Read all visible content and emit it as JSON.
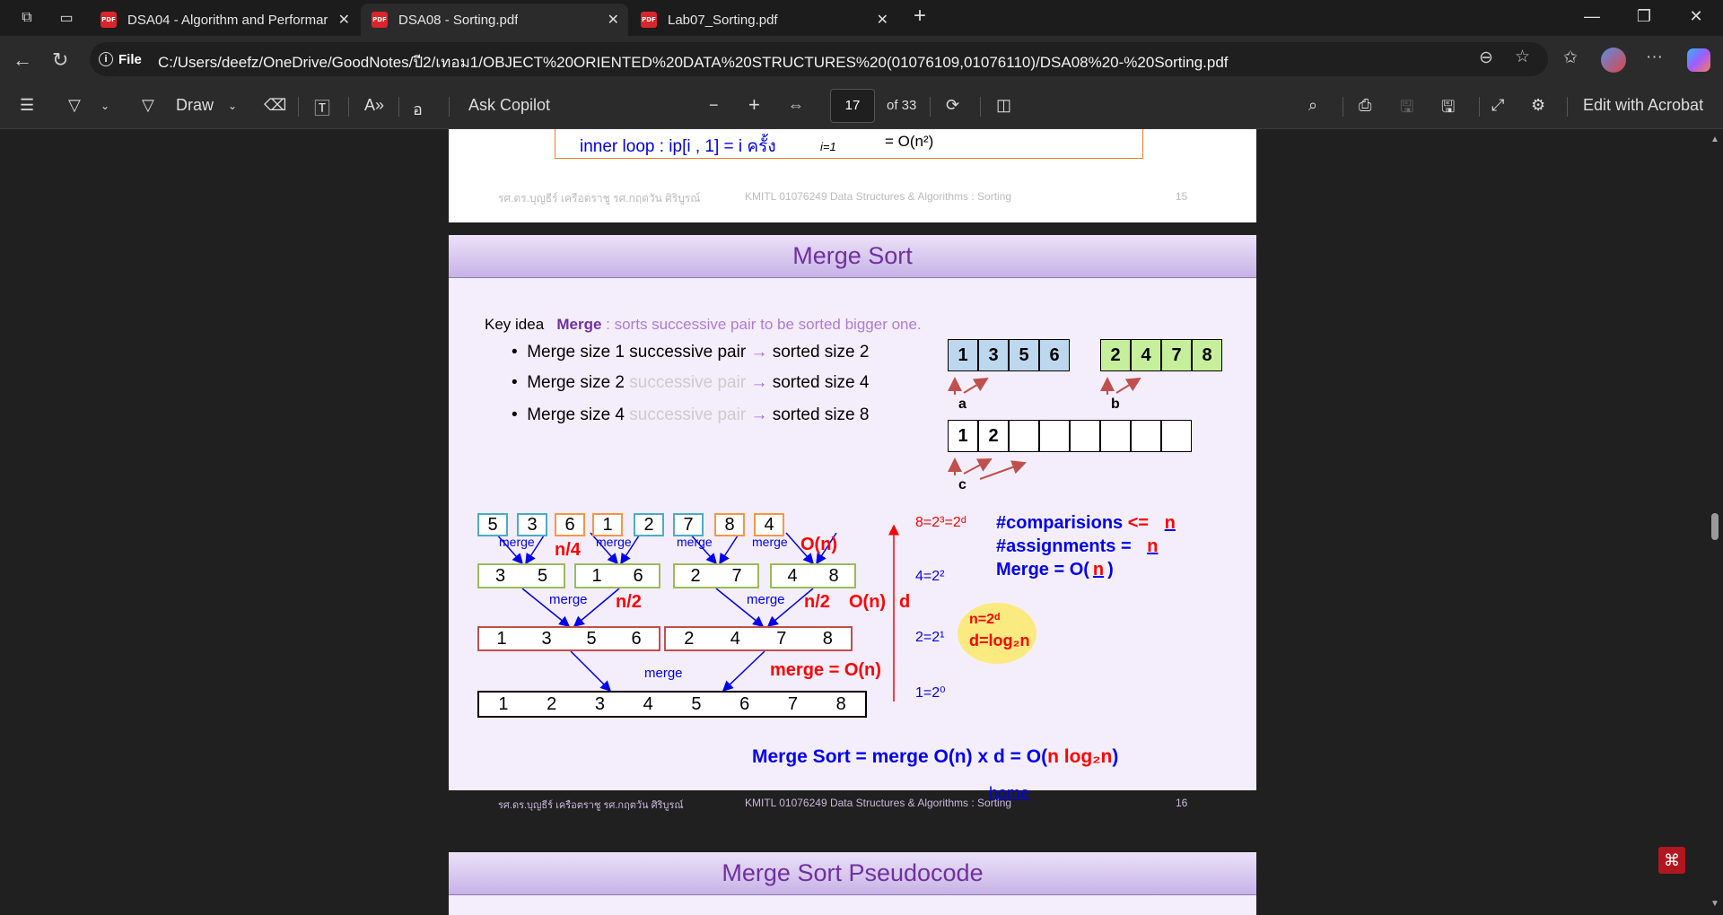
{
  "browser": {
    "tabs": [
      {
        "title": "DSA04 - Algorithm and Performar",
        "active": false
      },
      {
        "title": "DSA08 - Sorting.pdf",
        "active": true
      },
      {
        "title": "Lab07_Sorting.pdf",
        "active": false
      }
    ],
    "site_label": "File",
    "url": "C:/Users/deefz/OneDrive/GoodNotes/ปี2/เทอม1/OBJECT%20ORIENTED%20DATA%20STRUCTURES%20(01076109,01076110)/DSA08%20-%20Sorting.pdf",
    "pdf_badge": "PDF"
  },
  "toolbar": {
    "draw_label": "Draw",
    "copilot_label": "Ask Copilot",
    "page_current": "17",
    "page_total": "of 33",
    "acrobat_label": "Edit with Acrobat"
  },
  "prev_slide": {
    "inner_loop": "inner loop : ip[i , 1] = i ครั้ง",
    "sum_index": "i=1",
    "complexity": "= O(n²)",
    "footer_authors": "รศ.ดร.บุญธีร์ เครือตราชู  รศ.กฤตวัน ศิริบูรณ์",
    "footer_course": "KMITL    01076249 Data Structures & Algorithms : Sorting",
    "footer_page": "15"
  },
  "slide": {
    "title": "Merge Sort",
    "key_idea_label": "Key idea",
    "merge_word": "Merge",
    "key_idea_text": ": sorts successive pair to be sorted bigger one.",
    "bullets": [
      {
        "a": "Merge size 1 successive pair",
        "b": "",
        "arrow": "→",
        "c": "sorted size 2"
      },
      {
        "a": "Merge size 2",
        "b": "successive pair",
        "arrow": "→",
        "c": "sorted size 4"
      },
      {
        "a": "Merge size 4",
        "b": "successive pair",
        "arrow": "→",
        "c": "sorted size 8"
      }
    ],
    "array_a": [
      "1",
      "3",
      "5",
      "6"
    ],
    "array_b": [
      "2",
      "4",
      "7",
      "8"
    ],
    "array_c": [
      "1",
      "2",
      "",
      "",
      "",
      "",
      "",
      ""
    ],
    "label_a": "a",
    "label_b": "b",
    "label_c": "c",
    "level0": [
      "5",
      "3",
      "6",
      "1",
      "2",
      "7",
      "8",
      "4"
    ],
    "level1": [
      [
        "3",
        "5"
      ],
      [
        "1",
        "6"
      ],
      [
        "2",
        "7"
      ],
      [
        "4",
        "8"
      ]
    ],
    "level2": [
      [
        "1",
        "3",
        "5",
        "6"
      ],
      [
        "2",
        "4",
        "7",
        "8"
      ]
    ],
    "level3": [
      "1",
      "2",
      "3",
      "4",
      "5",
      "6",
      "7",
      "8"
    ],
    "merge_word_small": "merge",
    "n4": "n/4",
    "n2": "n/2",
    "on": "O(n)",
    "d": "d",
    "merge_on": "merge = O(n)",
    "lvl_labels": [
      "8=2³=2ᵈ",
      "4=2²",
      "2=2¹",
      "1=2⁰"
    ],
    "comparisons_label": "#comparisions",
    "comparisons_op": "<=",
    "comparisons_val": "n",
    "assignments_label": "#assignments  =",
    "assignments_val": "n",
    "merge_complexity_prefix": "Merge = O(",
    "merge_complexity_val": "n",
    "merge_complexity_suffix": ")",
    "note_n": "n=2ᵈ",
    "note_d": "d=log₂n",
    "summary_prefix": "Merge Sort = merge O(n) x  d = O(",
    "summary_red": "n log₂n",
    "summary_suffix": ")",
    "home_link": "home",
    "footer_authors": "รศ.ดร.บุญธีร์ เครือตราชู  รศ.กฤตวัน ศิริบูรณ์",
    "footer_course": "KMITL    01076249 Data Structures & Algorithms : Sorting",
    "footer_page": "16"
  },
  "next_slide": {
    "title": "Merge Sort Pseudocode"
  }
}
